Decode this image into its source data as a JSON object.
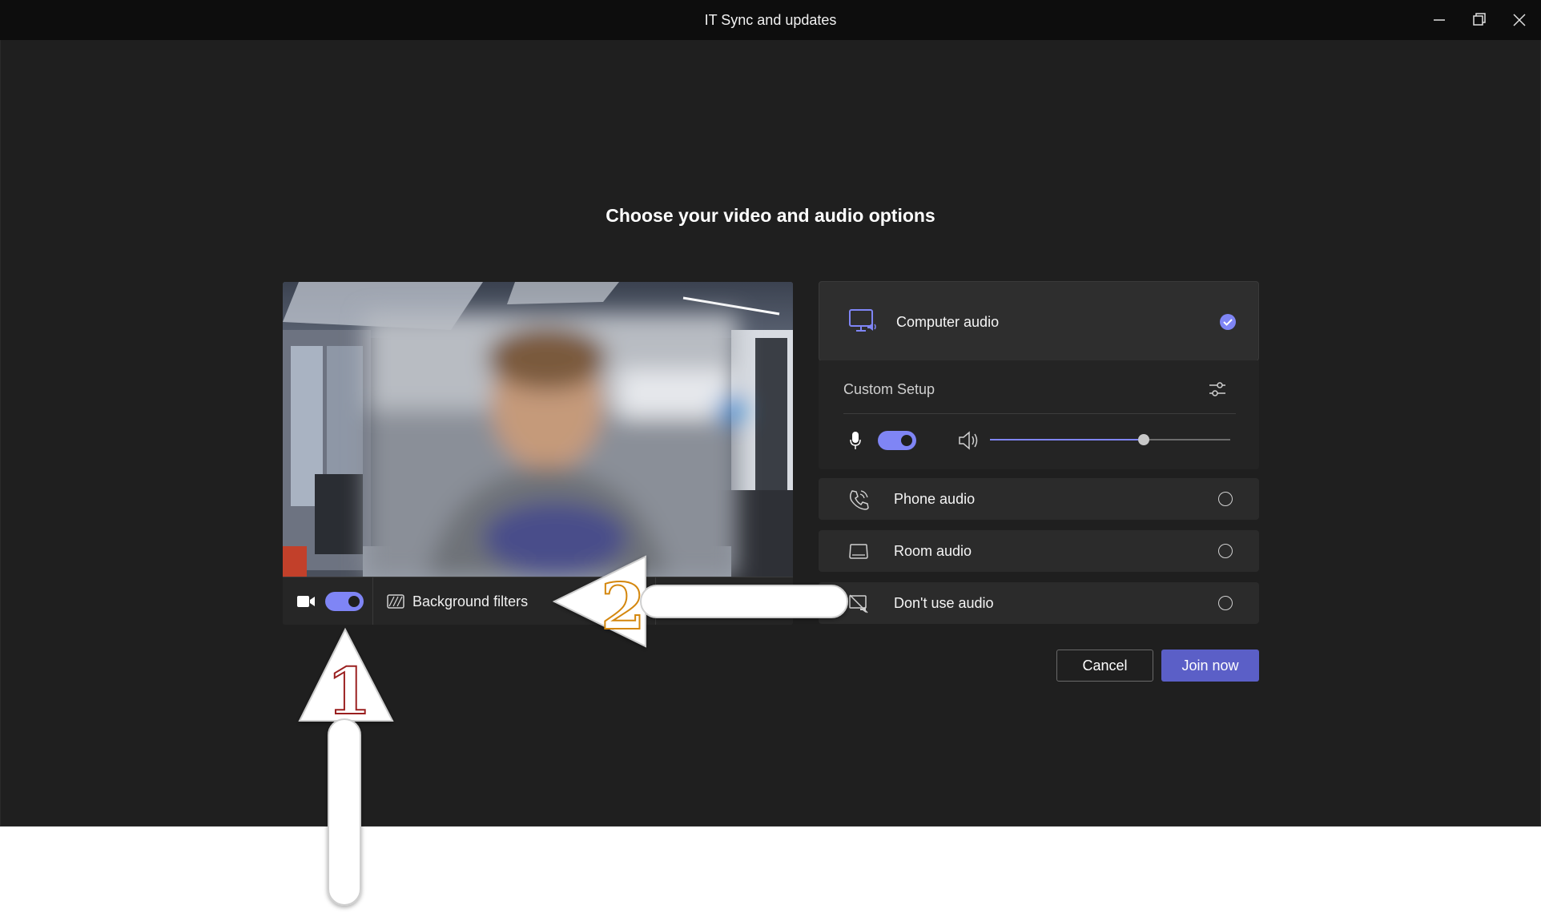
{
  "window": {
    "title": "IT Sync and updates"
  },
  "heading": "Choose your video and audio options",
  "video": {
    "camera_on": true,
    "background_filters_label": "Background filters"
  },
  "audio": {
    "computer_audio": {
      "label": "Computer audio",
      "selected": true
    },
    "custom_setup": {
      "label": "Custom Setup",
      "mic_on": true,
      "speaker_volume": 0.64
    },
    "options": [
      {
        "label": "Phone audio",
        "icon": "phone-icon",
        "selected": false
      },
      {
        "label": "Room audio",
        "icon": "room-icon",
        "selected": false
      },
      {
        "label": "Don't use audio",
        "icon": "no-audio-icon",
        "selected": false
      }
    ]
  },
  "buttons": {
    "cancel": "Cancel",
    "join": "Join now"
  },
  "annotations": {
    "step_1": "1",
    "step_2": "2"
  },
  "colors": {
    "accent": "#7f85f5",
    "join_button": "#5b5fc7",
    "background": "#1f1f1f",
    "titlebar": "#0d0d0d"
  }
}
